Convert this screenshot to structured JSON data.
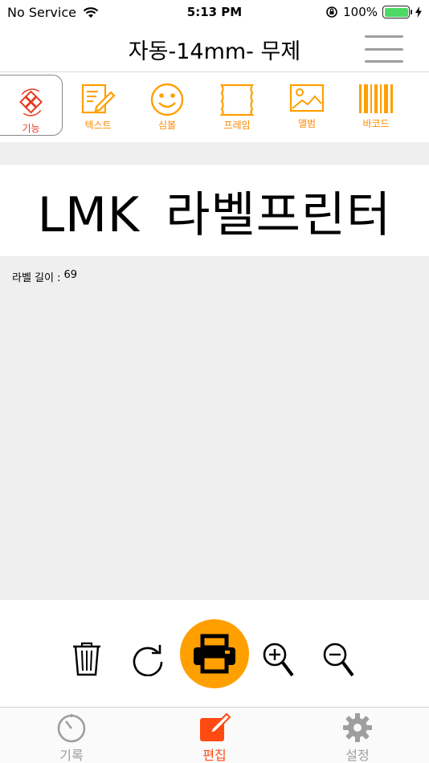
{
  "status_bar": {
    "carrier": "No Service",
    "time": "5:13 PM",
    "battery_percent": "100%",
    "battery_level": 1.0,
    "icons": [
      "wifi-icon",
      "rotation-lock-icon",
      "battery-icon",
      "charging-icon"
    ]
  },
  "nav": {
    "title": "자동-14mm- 무제",
    "menu_icon": "hamburger-menu-icon"
  },
  "toolbar": {
    "items": [
      {
        "label": "기능",
        "icon": "function-icon"
      },
      {
        "label": "텍스트",
        "icon": "text-edit-icon"
      },
      {
        "label": "심볼",
        "icon": "smiley-icon"
      },
      {
        "label": "프레임",
        "icon": "frame-icon"
      },
      {
        "label": "앨범",
        "icon": "image-icon"
      },
      {
        "label": "바코드",
        "icon": "barcode-icon"
      }
    ]
  },
  "label": {
    "text": "LMK 라벨프린터",
    "length_label": "라벨 길이 :",
    "length_value": "69"
  },
  "actions": {
    "items": [
      "trash-icon",
      "rotate-icon",
      "printer-icon",
      "zoom-in-icon",
      "zoom-out-icon"
    ]
  },
  "tabs": {
    "items": [
      {
        "label": "기록",
        "icon": "clock-icon"
      },
      {
        "label": "편집",
        "icon": "edit-icon"
      },
      {
        "label": "설정",
        "icon": "gear-icon"
      }
    ],
    "active": "편집"
  },
  "colors": {
    "accent_orange": "#ff9f00",
    "active_red": "#ff4a12",
    "inactive_gray": "#9e9e9e",
    "background_gray": "#efefef"
  }
}
